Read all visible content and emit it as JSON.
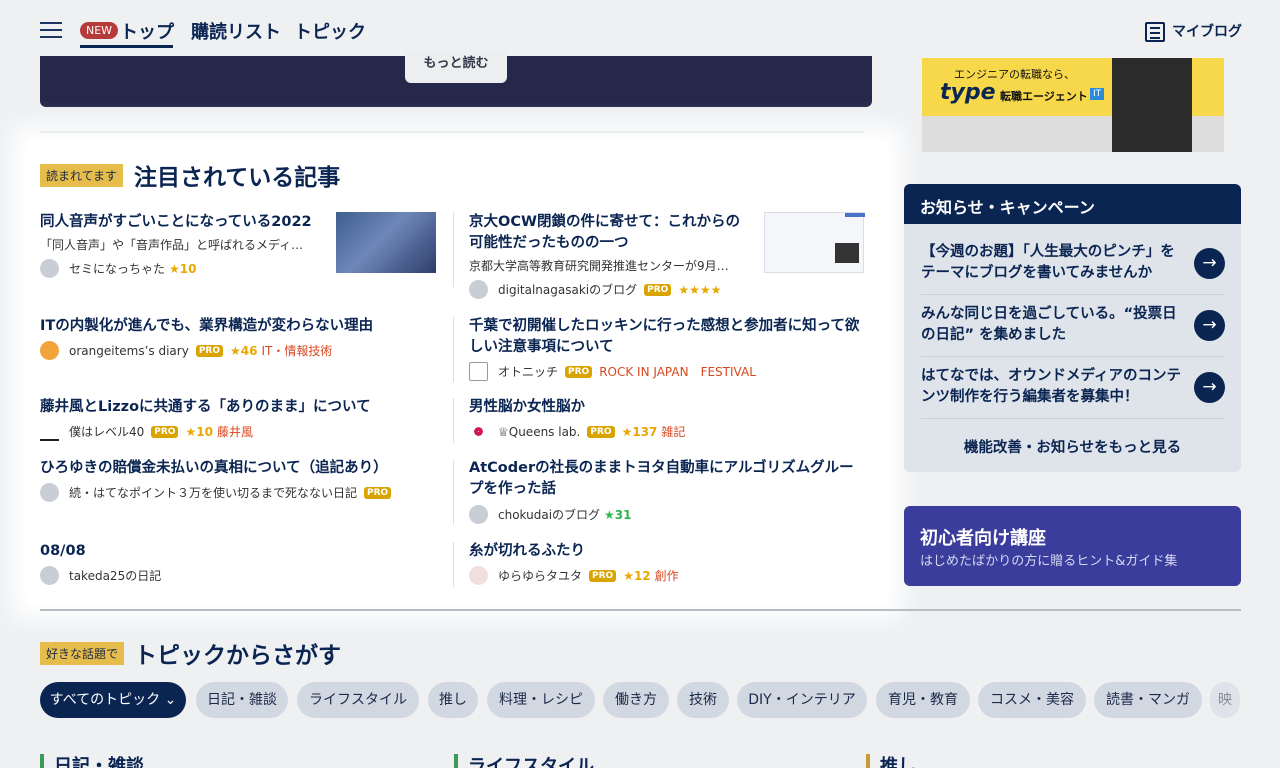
{
  "header": {
    "new_badge": "NEW",
    "nav": [
      "トップ",
      "購読リスト",
      "トピック"
    ],
    "myblog": "マイブログ"
  },
  "banner": {
    "read_more": "もっと読む"
  },
  "featured": {
    "tag": "読まれてます",
    "title": "注目されている記事",
    "articles": [
      {
        "title": "同人音声がすごいことになっている2022",
        "desc": "「同人音声」や「音声作品」と呼ばれるメディ…",
        "author": "セミになっちゃた",
        "stars": "★10",
        "pro": "",
        "category": ""
      },
      {
        "title": "京大OCW閉鎖の件に寄せて：これからの可能性だったものの一つ",
        "desc": "京都大学高等教育研究開発推進センターが9月…",
        "author": "digitalnagasakiのブログ",
        "stars": "★★★★",
        "pro": "PRO",
        "category": ""
      },
      {
        "title": "ITの内製化が進んでも、業界構造が変わらない理由",
        "desc": "",
        "author": "orangeitems’s diary",
        "stars": "★46",
        "pro": "PRO",
        "category": "IT・情報技術"
      },
      {
        "title": "千葉で初開催したロッキンに行った感想と参加者に知って欲しい注意事項について",
        "desc": "",
        "author": "オトニッチ",
        "stars": "",
        "pro": "PRO",
        "category": "ROCK IN JAPAN　FESTIVAL"
      },
      {
        "title": "藤井風とLizzoに共通する「ありのまま」について",
        "desc": "",
        "author": "僕はレベル40",
        "stars": "★10",
        "pro": "PRO",
        "category": "藤井風"
      },
      {
        "title": "男性脳か女性脳か",
        "desc": "",
        "author": "♕Queens lab.",
        "stars": "★137",
        "pro": "PRO",
        "category": "雑記"
      },
      {
        "title": "ひろゆきの賠償金未払いの真相について（追記あり）",
        "desc": "",
        "author": "続・はてなポイント３万を使い切るまで死なない日記",
        "stars": "",
        "pro": "PRO",
        "category": ""
      },
      {
        "title": "AtCoderの社長のままトヨタ自動車にアルゴリズムグループを作った話",
        "desc": "",
        "author": "chokudaiのブログ",
        "stars": "★31",
        "pro": "",
        "category": ""
      },
      {
        "title": "08/08",
        "desc": "",
        "author": "takeda25の日記",
        "stars": "",
        "pro": "",
        "category": ""
      },
      {
        "title": "糸が切れるふたり",
        "desc": "",
        "author": "ゆらゆらタユタ",
        "stars": "★12",
        "pro": "PRO",
        "category": "創作"
      }
    ]
  },
  "ad": {
    "line1": "エンジニアの転職なら、",
    "brand": "type",
    "line2": "転職エージェント",
    "badge": "IT"
  },
  "notice": {
    "title": "お知らせ・キャンペーン",
    "items": [
      "【今週のお題】「人生最大のピンチ」をテーマにブログを書いてみませんか",
      "みんな同じ日を過ごしている。“投票日の日記” を集めました",
      "はてなでは、オウンドメディアのコンテンツ制作を行う編集者を募集中！"
    ],
    "more": "機能改善・お知らせをもっと見る"
  },
  "beginner": {
    "title": "初心者向け講座",
    "subtitle": "はじめたばかりの方に贈るヒント&ガイド集"
  },
  "topics": {
    "tag": "好きな話題で",
    "title": "トピックからさがす",
    "chips": [
      "すべてのトピック ⌄",
      "日記・雑談",
      "ライフスタイル",
      "推し",
      "料理・レシピ",
      "働き方",
      "技術",
      "DIY・インテリア",
      "育児・教育",
      "コスメ・美容",
      "読書・マンガ",
      "映"
    ],
    "columns": [
      "日記・雑談",
      "ライフスタイル",
      "推し"
    ]
  },
  "colors": {
    "navy": "#0b2552",
    "accent": "#e6bd4a",
    "category": "#d84720",
    "purple": "#3b3d9c"
  }
}
